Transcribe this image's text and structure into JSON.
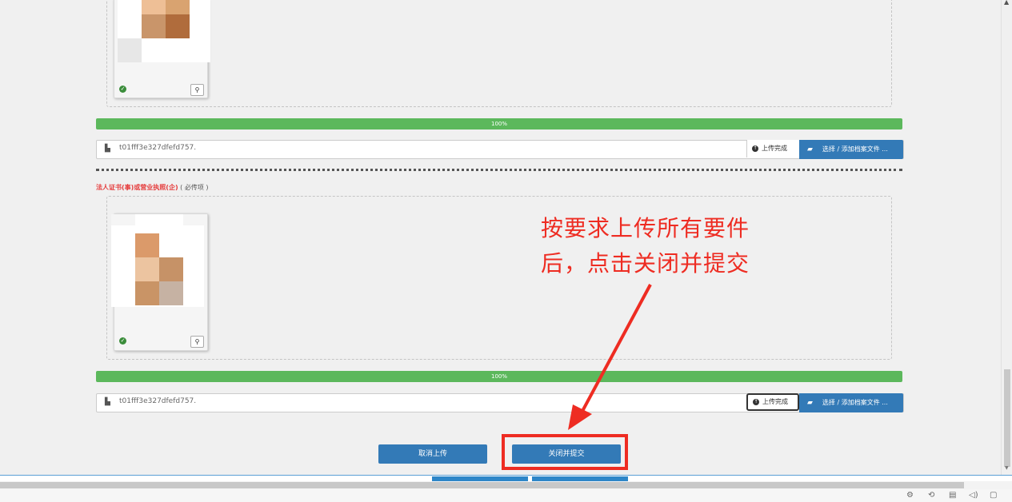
{
  "sections": [
    {
      "progress_label": "100%",
      "file": {
        "name": "t01fff3e327dfefd757.",
        "status": "上传完成",
        "choose_label": "选择 / 添加档案文件 ..."
      }
    },
    {
      "label_required": "法人证书(事)或营业执照(企)",
      "label_hint": "( 必传项 )",
      "progress_label": "100%",
      "file": {
        "name": "t01fff3e327dfefd757.",
        "status": "上传完成",
        "choose_label": "选择 / 添加档案文件 ..."
      }
    }
  ],
  "annotation": {
    "line1": "按要求上传所有要件",
    "line2": "后，点击关闭并提交"
  },
  "footer": {
    "cancel_label": "取消上传",
    "close_submit_label": "关闭并提交"
  },
  "icons": {
    "check": "check-icon",
    "zoom": "zoom-icon",
    "file": "file-icon",
    "upload": "upload-icon",
    "folder": "folder-open-icon"
  },
  "colors": {
    "progress": "#5cb85c",
    "primary_button": "#337ab7",
    "annotation": "#ee2c22",
    "required_label": "#e53b3b"
  }
}
